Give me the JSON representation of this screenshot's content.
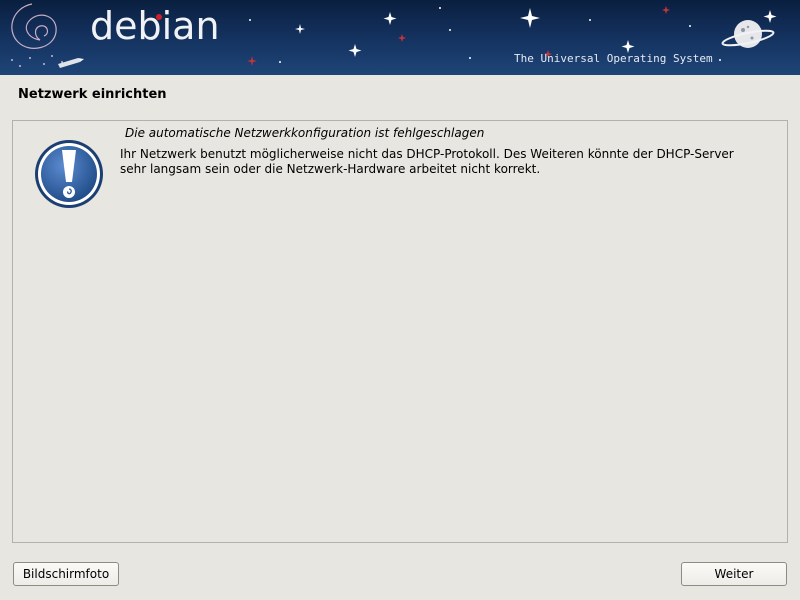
{
  "header": {
    "logo_text": "debian",
    "tagline": "The Universal Operating System"
  },
  "page": {
    "title": "Netzwerk einrichten"
  },
  "message": {
    "heading": "Die automatische Netzwerkkonfiguration ist fehlgeschlagen",
    "body_line1": "Ihr Netzwerk benutzt möglicherweise nicht das DHCP-Protokoll. Des Weiteren könnte der DHCP-Server",
    "body_line2": "sehr langsam sein oder die Netzwerk-Hardware arbeitet nicht korrekt.",
    "icon": "warning-exclamation-icon"
  },
  "buttons": {
    "screenshot_label": "Bildschirmfoto",
    "continue_label": "Weiter"
  },
  "colors": {
    "header_bg": "#13305c",
    "background": "#e8e6e0",
    "icon_blue": "#2b5a9a",
    "accent_red": "#d0202a"
  }
}
